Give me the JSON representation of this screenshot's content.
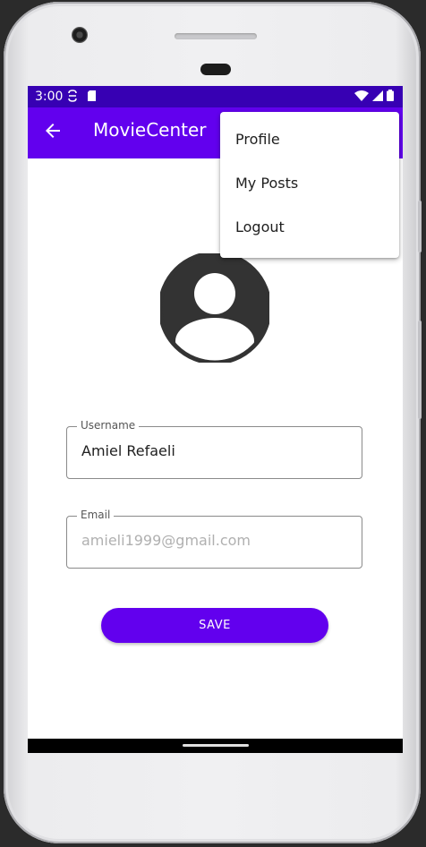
{
  "status_bar": {
    "time": "3:00"
  },
  "app_bar": {
    "title": "MovieCenter"
  },
  "overflow_menu": {
    "items": [
      "Profile",
      "My Posts",
      "Logout"
    ]
  },
  "form": {
    "username": {
      "label": "Username",
      "value": "Amiel Refaeli"
    },
    "email": {
      "label": "Email",
      "placeholder": "amieli1999@gmail.com"
    },
    "save_label": "SAVE"
  },
  "colors": {
    "primary": "#6200ee",
    "primary_dark": "#3700b3"
  }
}
